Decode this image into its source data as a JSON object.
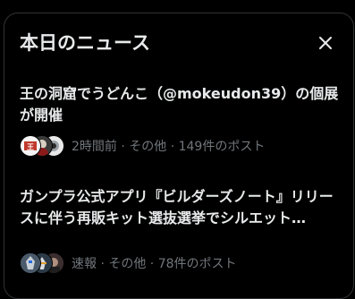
{
  "header": {
    "title": "本日のニュース",
    "close_icon": "close-icon"
  },
  "news": [
    {
      "headline": "王の洞窟でうどんこ（@mokeudon39）の個展が開催",
      "meta": "2時間前 · その他 · 149件のポスト",
      "avatar_icons": [
        "avatar-1",
        "avatar-2",
        "avatar-3"
      ]
    },
    {
      "headline": "ガンプラ公式アプリ『ビルダーズノート』リリースに伴う再販キット選抜選挙でシルエット…",
      "meta": "速報 · その他 · 78件のポスト",
      "avatar_icons": [
        "avatar-1",
        "avatar-2",
        "avatar-3"
      ]
    }
  ],
  "colors": {
    "background": "#000000",
    "border": "#2f3336",
    "text_primary": "#e7e9ea",
    "text_secondary": "#71767b"
  }
}
